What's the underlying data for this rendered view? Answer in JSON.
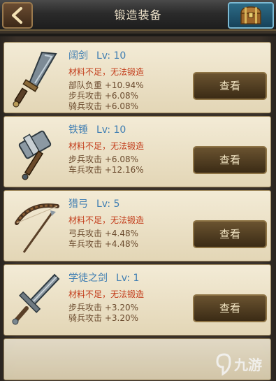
{
  "header": {
    "title": "锻造装备",
    "back_icon": "back-arrow-icon",
    "chest_icon": "treasure-chest-icon"
  },
  "items": [
    {
      "name": "阔剑",
      "level": "Lv: 10",
      "warning": "材料不足，无法锻造",
      "stats": [
        "部队负重 +10.94%",
        "步兵攻击 +6.08%",
        "骑兵攻击 +6.08%"
      ],
      "button": "查看",
      "icon": "broadsword-icon"
    },
    {
      "name": "铁锤",
      "level": "Lv: 10",
      "warning": "材料不足，无法锻造",
      "stats": [
        "步兵攻击 +6.08%",
        "车兵攻击 +12.16%"
      ],
      "button": "查看",
      "icon": "hammer-icon"
    },
    {
      "name": "猎弓",
      "level": "Lv: 5",
      "warning": "材料不足，无法锻造",
      "stats": [
        "弓兵攻击 +4.48%",
        "车兵攻击 +4.48%"
      ],
      "button": "查看",
      "icon": "hunting-bow-icon"
    },
    {
      "name": "学徒之剑",
      "level": "Lv: 1",
      "warning": "材料不足，无法锻造",
      "stats": [
        "步兵攻击 +3.20%",
        "骑兵攻击 +3.20%"
      ],
      "button": "查看",
      "icon": "apprentice-sword-icon"
    }
  ],
  "watermark": {
    "text": "九游",
    "icon": "jiuyou-logo-icon"
  },
  "colors": {
    "name": "#3e7db2",
    "warning": "#c23a18",
    "stat": "#6b4b2e",
    "button_bg": "#4f3c21"
  }
}
